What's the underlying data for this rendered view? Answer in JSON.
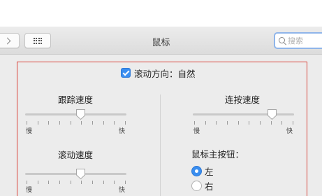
{
  "window": {
    "title": "鼠标"
  },
  "toolbar": {
    "search_placeholder": "搜索"
  },
  "scroll_direction": {
    "label": "滚动方向：自然",
    "checked": true
  },
  "tracking_speed": {
    "title": "跟踪速度",
    "min_label": "慢",
    "max_label": "快",
    "value_fraction": 0.55
  },
  "double_click_speed": {
    "title": "连按速度",
    "min_label": "慢",
    "max_label": "快",
    "value_fraction": 0.78
  },
  "scrolling_speed": {
    "title": "滚动速度",
    "min_label": "慢",
    "max_label": "快",
    "value_fraction": 0.55
  },
  "primary_button": {
    "title": "鼠标主按钮：",
    "options": [
      {
        "label": "左",
        "selected": true
      },
      {
        "label": "右",
        "selected": false
      }
    ]
  }
}
